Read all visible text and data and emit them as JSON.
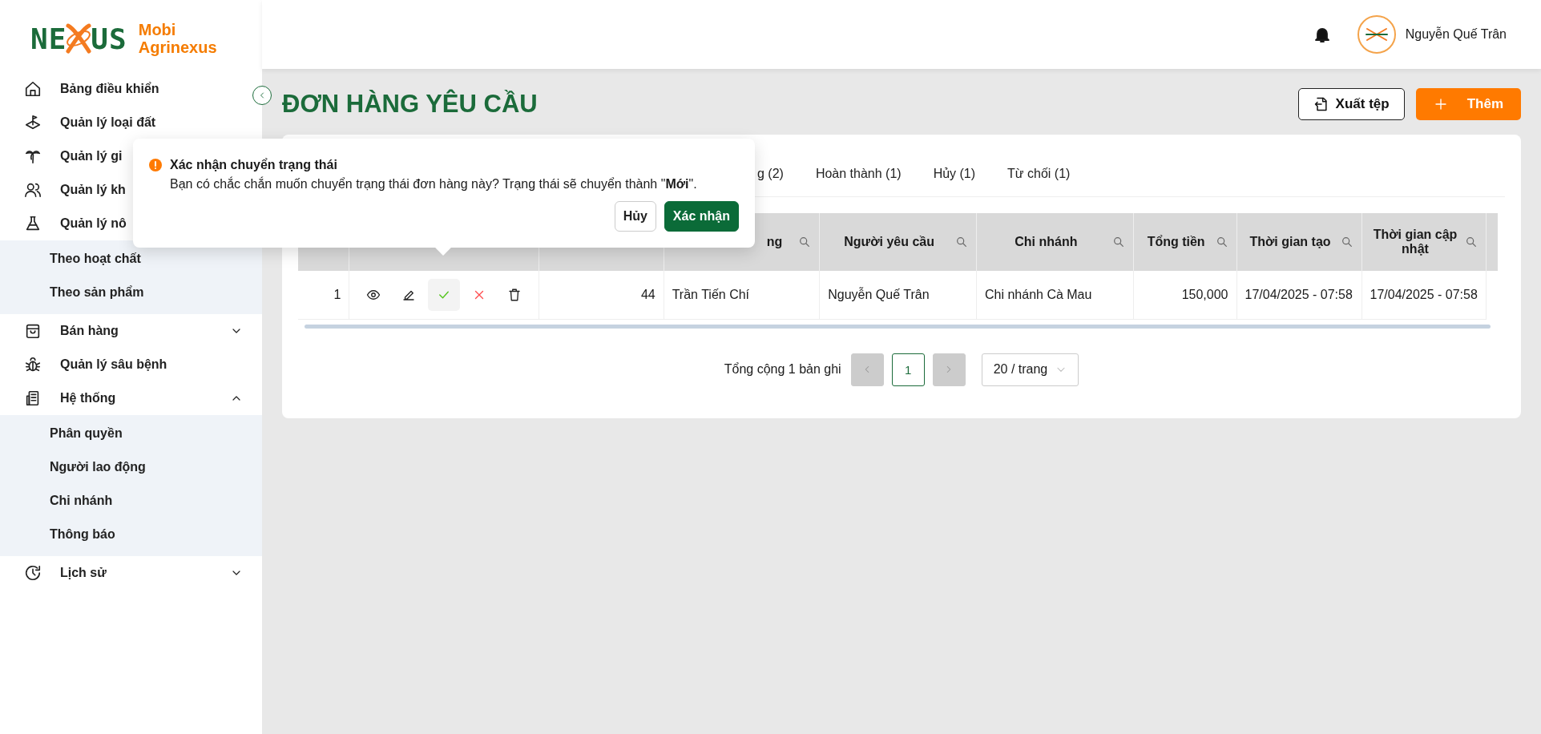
{
  "logo": {
    "left": "NE",
    "right": "US",
    "title": "Mobi",
    "subtitle": "Agrinexus"
  },
  "user": {
    "name": "Nguyễn Quế Trân"
  },
  "sidebar": {
    "items": [
      {
        "label": "Bảng điều khiển"
      },
      {
        "label": "Quản lý loại đất"
      },
      {
        "label": "Quản lý gi"
      },
      {
        "label": "Quản lý kh"
      },
      {
        "label": "Quản lý nô",
        "children": [
          {
            "label": "Theo hoạt chất"
          },
          {
            "label": "Theo sản phẩm"
          }
        ]
      },
      {
        "label": "Bán hàng",
        "expanded": false
      },
      {
        "label": "Quản lý sâu bệnh"
      },
      {
        "label": "Hệ thống",
        "expanded": true,
        "children": [
          {
            "label": "Phân quyền"
          },
          {
            "label": "Người lao động"
          },
          {
            "label": "Chi nhánh"
          },
          {
            "label": "Thông báo"
          }
        ]
      },
      {
        "label": "Lịch sử",
        "expanded": false
      }
    ]
  },
  "page": {
    "title": "ĐƠN HÀNG YÊU CẦU",
    "buttons": [
      {
        "kind": "export",
        "label": "Xuất tệp"
      },
      {
        "kind": "add",
        "label": "Thêm"
      }
    ]
  },
  "tabs": [
    {
      "label": "g (2)"
    },
    {
      "label": "Hoàn thành (1)"
    },
    {
      "label": "Hủy (1)"
    },
    {
      "label": "Từ chối (1)"
    }
  ],
  "table": {
    "columns": [
      {},
      {},
      {},
      {
        "label": "ng",
        "searchable": true
      },
      {
        "label": "Người yêu cầu",
        "searchable": true
      },
      {
        "label": "Chi nhánh",
        "searchable": true
      },
      {
        "label": "Tổng tiền",
        "searchable": true
      },
      {
        "label": "Thời gian tạo",
        "searchable": true
      },
      {
        "label": "Thời gian cập nhật",
        "searchable": true
      }
    ],
    "rows": [
      {
        "cells": [
          {
            "text": "1"
          },
          {
            "kind": "actions",
            "actions": [
              {
                "kind": "view",
                "highlighted": false
              },
              {
                "kind": "edit",
                "highlighted": false
              },
              {
                "kind": "approve",
                "highlighted": true
              },
              {
                "kind": "reject",
                "highlighted": false
              },
              {
                "kind": "delete",
                "highlighted": false
              }
            ]
          },
          {
            "text": "44"
          },
          {
            "text": "Trần Tiến Chí"
          },
          {
            "text": "Nguyễn Quế Trân"
          },
          {
            "text": "Chi nhánh Cà Mau"
          },
          {
            "text": "150,000"
          },
          {
            "text": "17/04/2025 - 07:58"
          },
          {
            "text": "17/04/2025 - 07:58"
          }
        ]
      }
    ]
  },
  "pagination": {
    "total": "Tổng cộng 1 bản ghi",
    "prev_disabled": true,
    "pages": [
      {
        "label": "1",
        "selected": true
      }
    ],
    "next_disabled": true,
    "page_size": "20 / trang"
  },
  "popconfirm": {
    "title": "Xác nhận chuyển trạng thái",
    "message": "Bạn có chắc chắn muốn chuyển trạng thái đơn hàng này? Trạng thái sẽ chuyển thành \"**Mới**\".",
    "buttons": [
      {
        "kind": "cancel",
        "label": "Hủy"
      },
      {
        "kind": "confirm",
        "label": "Xác nhận"
      }
    ]
  }
}
